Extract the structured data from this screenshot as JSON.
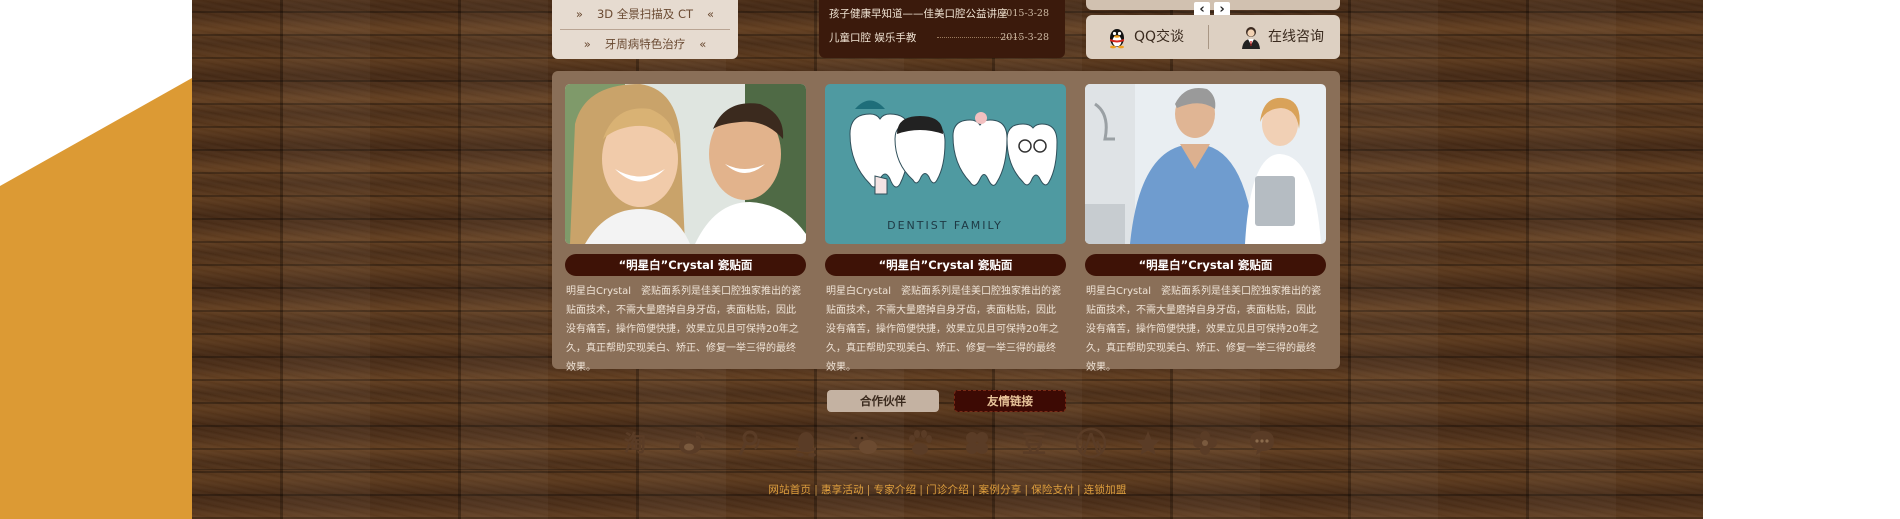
{
  "services": {
    "items": [
      {
        "label": "3D 全景扫描及 CT"
      },
      {
        "label": "牙周病特色治疗"
      }
    ],
    "arrow_left": "»",
    "arrow_right": "«"
  },
  "news": {
    "items": [
      {
        "title": "孩子健康早知道——佳美口腔公益讲座",
        "date": "2015-3-28"
      },
      {
        "title": "儿童口腔 娱乐手教",
        "date": "2015-3-28"
      }
    ]
  },
  "contact": {
    "prev_label": "‹",
    "next_label": "›",
    "qq_label": "QQ交谈",
    "consult_label": "在线咨询"
  },
  "cards": [
    {
      "title": "“明星白”Crystal 瓷贴面",
      "desc": "明星白Crystal　瓷贴面系列是佳美口腔独家推出的瓷贴面技术，不需大量磨掉自身牙齿，表面粘贴，因此没有痛苦，操作简便快捷，效果立见且可保持20年之久，真正帮助实现美白、矫正、修复一举三得的最终效果。"
    },
    {
      "title": "“明星白”Crystal 瓷贴面",
      "desc": "明星白Crystal　瓷贴面系列是佳美口腔独家推出的瓷贴面技术，不需大量磨掉自身牙齿，表面粘贴，因此没有痛苦，操作简便快捷，效果立见且可保持20年之久，真正帮助实现美白、矫正、修复一举三得的最终效果。",
      "image_caption": "DENTIST FAMILY"
    },
    {
      "title": "“明星白”Crystal 瓷贴面",
      "desc": "明星白Crystal　瓷贴面系列是佳美口腔独家推出的瓷贴面技术，不需大量磨掉自身牙齿，表面粘贴，因此没有痛苦，操作简便快捷，效果立见且可保持20年之久，真正帮助实现美白、矫正、修复一举三得的最终效果。"
    }
  ],
  "tabs": {
    "partner_label": "合作伙伴",
    "links_label": "友情链接"
  },
  "social_icons": [
    "taobao-icon",
    "weibo-icon",
    "tencent-weibo-icon",
    "qq-icon",
    "wechat-icon",
    "baidu-icon",
    "kaixin-icon",
    "douban-icon",
    "renren-icon",
    "favorite-icon",
    "flower-icon",
    "message-icon"
  ],
  "taobao_glyph": "淘",
  "douban_glyph": "豆",
  "footer": {
    "links": [
      "网站首页",
      "惠享活动",
      "专家介绍",
      "门诊介绍",
      "案例分享",
      "保险支付",
      "连锁加盟"
    ],
    "separator": "|"
  },
  "colors": {
    "accent_orange": "#dc9a34",
    "panel_brown": "#3e1206",
    "footer_link": "#e0a03e"
  }
}
